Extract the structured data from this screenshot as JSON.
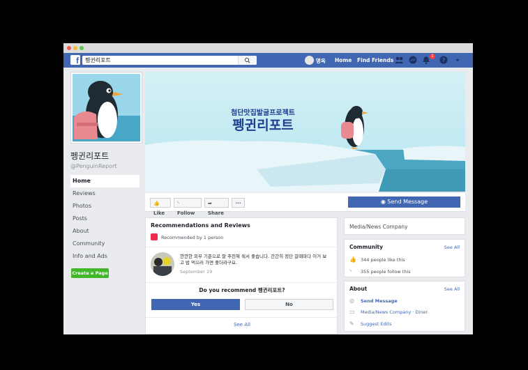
{
  "search": {
    "value": "펭귄리포트"
  },
  "nav": {
    "user": "명옥",
    "home": "Home",
    "find_friends": "Find Friends",
    "notif_count": "1"
  },
  "page": {
    "name": "펭귄리포트",
    "handle": "@PenguinReport"
  },
  "left_nav": [
    "Home",
    "Reviews",
    "Photos",
    "Posts",
    "About",
    "Community",
    "Info and Ads"
  ],
  "create_page": "Create a Page",
  "cover": {
    "subtitle": "첨단맛집발굴프로젝트",
    "title": "펭귄리포트"
  },
  "actions": {
    "like": "Like",
    "follow": "Follow",
    "share": "Share",
    "more": "···",
    "send_message": "Send Message"
  },
  "reviews": {
    "title": "Recommendations and Reviews",
    "recommended_by": "Recommended by 1 person",
    "review_text": "깐깐한 외부 기준으로 잘 추천해 줘서 좋습니다. 간간히 정단 갈때마다 이거 보고 밥 먹으러 가면 좋더라구요.",
    "review_date": "September 19",
    "question": "Do you recommend 펭귄리포트?",
    "yes": "Yes",
    "no": "No",
    "see_all": "See All"
  },
  "category": "Media/News Company",
  "community": {
    "title": "Community",
    "see_all": "See All",
    "likes": "344 people like this",
    "follows": "355 people follow this"
  },
  "about": {
    "title": "About",
    "see_all": "See All",
    "send_message": "Send Message",
    "category": "Media/News Company · Diner",
    "suggest_edits": "Suggest Edits"
  },
  "colors": {
    "fb_blue": "#4267b2",
    "green": "#42b72a",
    "background": "#e9ebee"
  }
}
